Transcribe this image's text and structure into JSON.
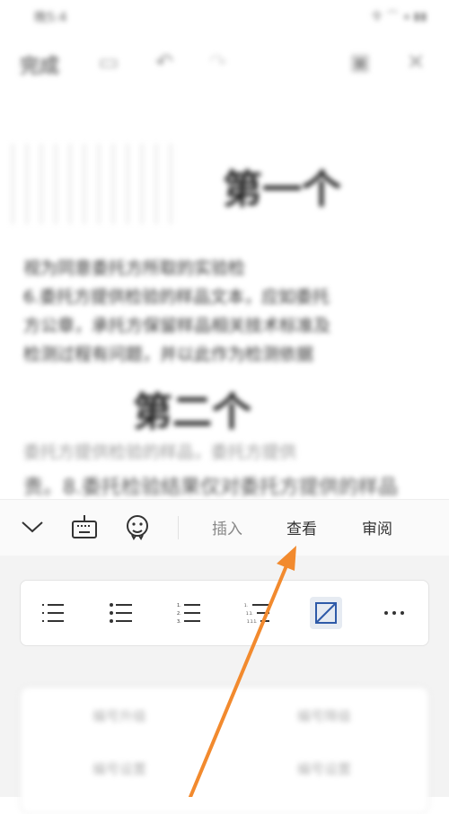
{
  "status": {
    "time": "晚5:4",
    "icons": "令 ⌒ ◂ ▮▮"
  },
  "appbar": {
    "done_label": "完成"
  },
  "doc": {
    "heading1": "第一个",
    "para_lines": [
      "视为同意委托方所取的实验检",
      "6.委托方提供检验的样品文本，应如委托",
      "方公章，承托方保留样品相关技术标准及",
      "检测过程有问题，并以此作为检测依据"
    ],
    "heading2": "第二个",
    "line4": "委托方提供检验的样品，委托方提供",
    "line5": "责。8.委托检验结果仅对委托方提供的样品"
  },
  "toolbar": {
    "tabs": [
      "插入",
      "查看",
      "审阅"
    ]
  },
  "panel": {
    "card2": {
      "promote": "编号升级",
      "demote": "编号降级",
      "row2a": "编号设置",
      "row2b": "编号设置"
    }
  },
  "colors": {
    "accent": "#f28a2e",
    "selected_bg": "#e6ebf2",
    "icon": "#333333"
  }
}
